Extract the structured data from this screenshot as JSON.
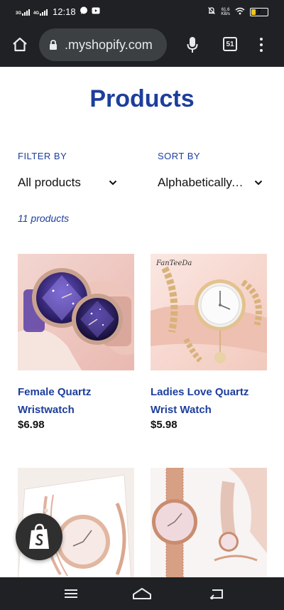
{
  "status_bar": {
    "net1": "3G",
    "net2": "4G",
    "time": "12:18",
    "speed_value": "61.6",
    "speed_unit": "KB/s",
    "battery_level": "7",
    "battery_fraction": 0.07
  },
  "browser": {
    "url": ".myshopify.com",
    "tab_count": "51"
  },
  "page": {
    "title": "Products",
    "filter_label": "FILTER BY",
    "filter_value": "All products",
    "sort_label": "SORT BY",
    "sort_value": "Alphabetically, A-Z",
    "product_count": "11 products"
  },
  "products": [
    {
      "name": "Female Quartz Wristwatch",
      "price": "$6.98"
    },
    {
      "name": "Ladies Love Quartz Wrist Watch",
      "price": "$5.98",
      "watermark": "FanTeeDa"
    },
    {
      "name": "",
      "price": ""
    },
    {
      "name": "",
      "price": ""
    }
  ],
  "icons": {
    "home": "home-icon",
    "lock": "lock-icon",
    "mic": "mic-icon",
    "menu": "more-vert-icon",
    "shopify": "shopify-bag-icon",
    "nav_menu": "hamburger-icon",
    "nav_home": "home-nav-icon",
    "nav_back": "back-icon"
  },
  "colors": {
    "accent": "#1d3e9c",
    "chrome_dark": "#202124",
    "url_pill": "#3c4043",
    "battery": "#f5c518"
  }
}
